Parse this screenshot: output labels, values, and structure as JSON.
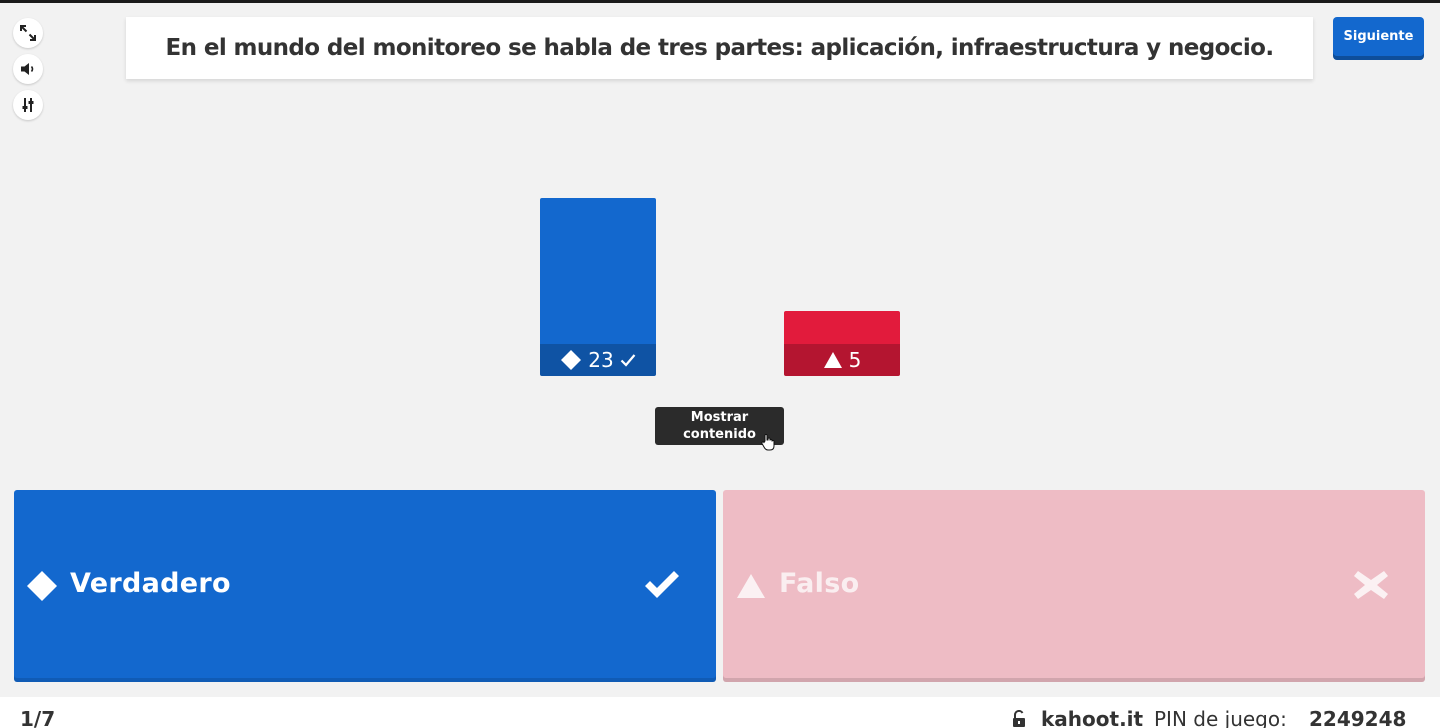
{
  "question": "En el mundo del monitoreo se habla de tres partes: aplicación, infraestructura y negocio.",
  "next_button": "Siguiente",
  "side_controls": [
    "fullscreen-icon",
    "volume-icon",
    "settings-sliders-icon"
  ],
  "results": [
    {
      "shape": "diamond-icon",
      "count": "23",
      "correct": true,
      "color": "#1368ce",
      "value": 23
    },
    {
      "shape": "triangle-icon",
      "count": "5",
      "correct": false,
      "color": "#e21b3c",
      "value": 5
    }
  ],
  "tooltip": "Mostrar contenido",
  "answers": [
    {
      "shape": "diamond-icon",
      "label": "Verdadero",
      "result_icon": "check-icon",
      "color": "#1368ce"
    },
    {
      "shape": "triangle-icon",
      "label": "Falso",
      "result_icon": "cross-icon",
      "color": "#eebcc5"
    }
  ],
  "footer": {
    "counter": "1/7",
    "site": "kahoot.it",
    "pin_label": "PIN de juego:",
    "pin_value": "2249248"
  }
}
